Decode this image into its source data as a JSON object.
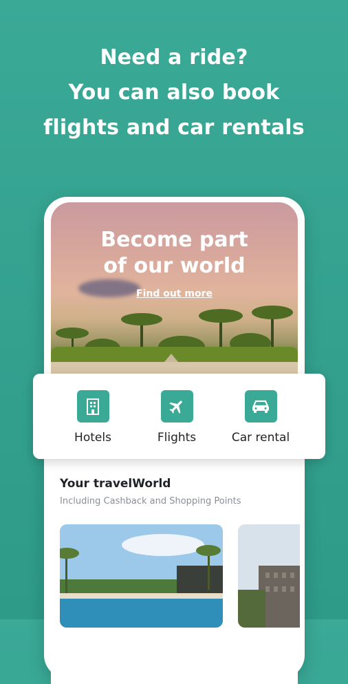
{
  "headline": {
    "line1": "Need a ride?",
    "line2": "You can also book",
    "line3": "flights and car rentals"
  },
  "hero": {
    "title_line1": "Become part",
    "title_line2": "of our world",
    "link": "Find out more"
  },
  "categories": [
    {
      "label": "Hotels",
      "icon": "hotel-building-icon"
    },
    {
      "label": "Flights",
      "icon": "airplane-icon"
    },
    {
      "label": "Car rental",
      "icon": "car-icon"
    }
  ],
  "section": {
    "title": "Your travelWorld",
    "subtitle": "Including Cashback and Shopping Points"
  },
  "colors": {
    "accent": "#3aa996",
    "background": "#2e9a88"
  }
}
